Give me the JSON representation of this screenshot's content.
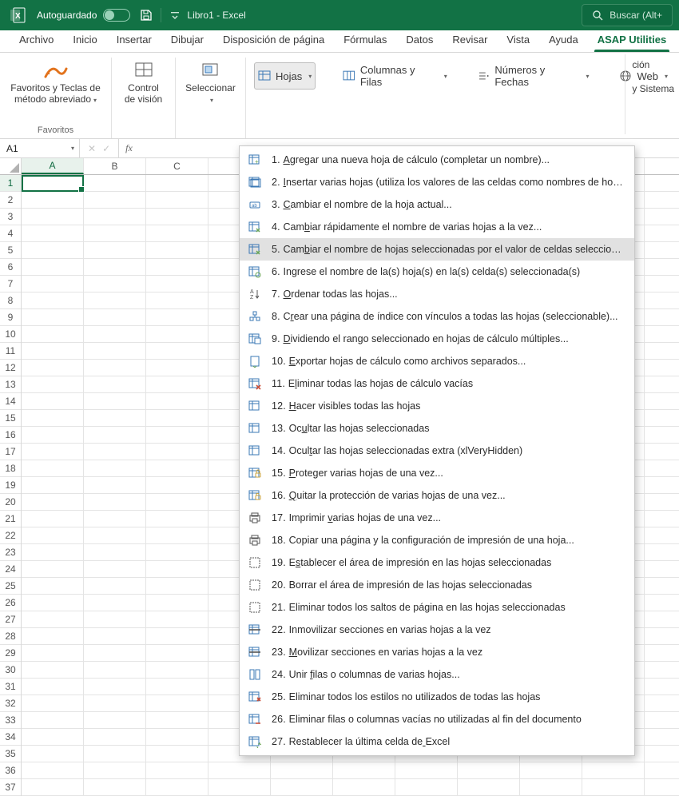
{
  "titlebar": {
    "autosave_label": "Autoguardado",
    "autosave_on": false,
    "doc_title": "Libro1 - Excel",
    "search_placeholder": "Buscar (Alt+"
  },
  "tabs": [
    {
      "label": "Archivo"
    },
    {
      "label": "Inicio"
    },
    {
      "label": "Insertar"
    },
    {
      "label": "Dibujar"
    },
    {
      "label": "Disposición de página"
    },
    {
      "label": "Fórmulas"
    },
    {
      "label": "Datos"
    },
    {
      "label": "Revisar"
    },
    {
      "label": "Vista"
    },
    {
      "label": "Ayuda"
    },
    {
      "label": "ASAP Utilities",
      "active": true
    }
  ],
  "ribbon": {
    "favorites": {
      "line1": "Favoritos y Teclas de",
      "line2": "método abreviado",
      "group_label": "Favoritos"
    },
    "vision": {
      "line1": "Control",
      "line2": "de visión"
    },
    "select": {
      "line1": "Seleccionar"
    },
    "hojas_btn": "Hojas",
    "colfilas_btn": "Columnas y Filas",
    "numfechas_btn": "Números y Fechas",
    "web_btn": "Web",
    "right1": "ción",
    "right2": "y Sistema"
  },
  "namebox": "A1",
  "columns": [
    "A",
    "B",
    "C",
    "",
    "",
    "",
    "",
    "",
    "",
    ""
  ],
  "row_count": 37,
  "menu": {
    "highlight_index": 4,
    "items": [
      {
        "prefix": "1. ",
        "accel_at": 0,
        "rest": "Agregar una nueva hoja de cálculo (completar un nombre)..."
      },
      {
        "prefix": "2. ",
        "accel_at": 0,
        "rest": "Insertar varias hojas (utiliza los valores de las celdas como nombres de hoja)..."
      },
      {
        "prefix": "3. ",
        "accel_at": 0,
        "rest": "Cambiar el nombre de la hoja actual..."
      },
      {
        "prefix": "4. ",
        "accel_at": 3,
        "rest": "Cambiar rápidamente el nombre de varias hojas a la vez..."
      },
      {
        "prefix": "5. ",
        "accel_at": 3,
        "rest": "Cambiar el nombre de hojas seleccionadas por el valor de celdas seleccionadas"
      },
      {
        "prefix": "6. ",
        "accel_at": 2,
        "rest": "Ingrese el nombre de la(s) hoja(s) en la(s) celda(s) seleccionada(s)"
      },
      {
        "prefix": "7. ",
        "accel_at": 0,
        "rest": "Ordenar todas las hojas..."
      },
      {
        "prefix": "8. ",
        "accel_at": 1,
        "rest": "Crear una página de índice con vínculos a todas las hojas (seleccionable)..."
      },
      {
        "prefix": "9. ",
        "accel_at": 0,
        "rest": "Dividiendo el rango seleccionado en hojas de cálculo múltiples..."
      },
      {
        "prefix": "10. ",
        "accel_at": 0,
        "rest": "Exportar hojas de cálculo como archivos separados..."
      },
      {
        "prefix": "11. ",
        "accel_at": 1,
        "rest": "Eliminar todas las hojas de cálculo vacías"
      },
      {
        "prefix": "12. ",
        "accel_at": 0,
        "rest": "Hacer visibles todas las hojas"
      },
      {
        "prefix": "13. ",
        "accel_at": 2,
        "rest": "Ocultar las hojas seleccionadas"
      },
      {
        "prefix": "14. ",
        "accel_at": 4,
        "rest": "Ocultar las hojas seleccionadas extra (xlVeryHidden)"
      },
      {
        "prefix": "15. ",
        "accel_at": 0,
        "rest": "Proteger varias hojas de una vez..."
      },
      {
        "prefix": "16. ",
        "accel_at": 0,
        "rest": "Quitar la protección de varias hojas de una vez..."
      },
      {
        "prefix": "17. ",
        "accel_at": 9,
        "rest": "Imprimir varias hojas de una vez..."
      },
      {
        "prefix": "18. ",
        "accel_at": -1,
        "rest": "Copiar una página y la configuración de impresión de una hoja..."
      },
      {
        "prefix": "19. ",
        "accel_at": 1,
        "rest": "Establecer el área de impresión en las hojas seleccionadas"
      },
      {
        "prefix": "20. ",
        "accel_at": -1,
        "rest": "Borrar el área de impresión de las hojas seleccionadas"
      },
      {
        "prefix": "21. ",
        "accel_at": -1,
        "rest": "Eliminar todos los saltos de página en las hojas seleccionadas"
      },
      {
        "prefix": "22. ",
        "accel_at": -1,
        "rest": "Inmovilizar secciones en varias hojas a la vez"
      },
      {
        "prefix": "23. ",
        "accel_at": 0,
        "rest": "Movilizar secciones en varias hojas a la vez"
      },
      {
        "prefix": "24. ",
        "accel_at": 5,
        "rest": "Unir filas o columnas de varias hojas..."
      },
      {
        "prefix": "25. ",
        "accel_at": -1,
        "rest": "Eliminar todos los estilos no utilizados de todas las hojas"
      },
      {
        "prefix": "26. ",
        "accel_at": -1,
        "rest": "Eliminar filas o columnas vacías no utilizadas al fin del documento"
      },
      {
        "prefix": "27. ",
        "accel_at": 30,
        "rest": "Restablecer la última celda de Excel"
      }
    ]
  }
}
